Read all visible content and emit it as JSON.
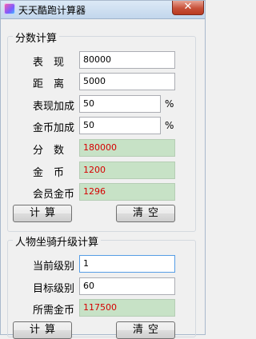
{
  "window": {
    "title": "天天酷跑计算器",
    "close_glyph": "✕"
  },
  "score_group": {
    "title": "分数计算",
    "performance_label": "表　现",
    "performance_value": "80000",
    "distance_label": "距　离",
    "distance_value": "5000",
    "performance_bonus_label": "表现加成",
    "performance_bonus_value": "50",
    "coin_bonus_label": "金币加成",
    "coin_bonus_value": "50",
    "percent_sign": "%",
    "score_label": "分　数",
    "score_value": "180000",
    "coins_label": "金　币",
    "coins_value": "1200",
    "vip_coins_label": "会员金币",
    "vip_coins_value": "1296",
    "calc_label": "计算",
    "clear_label": "清空"
  },
  "mount_group": {
    "title": "人物坐骑升级计算",
    "current_level_label": "当前级别",
    "current_level_value": "1",
    "target_level_label": "目标级别",
    "target_level_value": "60",
    "required_coins_label": "所需金币",
    "required_coins_value": "117500",
    "calc_label": "计算",
    "clear_label": "清空"
  },
  "colors": {
    "output_bg": "#c7e2c6",
    "output_text": "#d60000"
  }
}
